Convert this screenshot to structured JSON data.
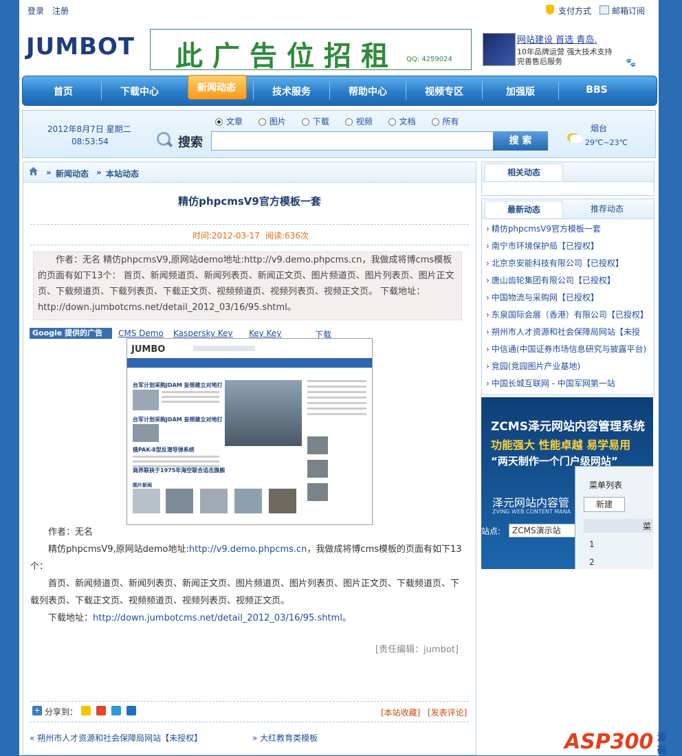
{
  "topbar": {
    "login": "登录",
    "register": "注册",
    "payment": "支付方式",
    "subscribe": "邮箱订阅"
  },
  "logo": "JUMBOT",
  "ad": {
    "text": "此广告位招租",
    "qq": "QQ: 4259024"
  },
  "promo": {
    "title": "网站建设 首选 青岛.",
    "line1": "10年品牌运营 强大技术支持",
    "line2": "完善售后服务"
  },
  "nav": {
    "items": [
      "首页",
      "下载中心",
      "新闻动态",
      "技术服务",
      "帮助中心",
      "视频专区",
      "加强版",
      "BBS"
    ],
    "active": "新闻动态"
  },
  "search": {
    "date": "2012年8月7日 星期二",
    "time": "08:53:54",
    "label": "搜索",
    "options": [
      "文章",
      "图片",
      "下载",
      "视频",
      "文档",
      "所有"
    ],
    "selected": "文章",
    "button": "搜 索",
    "city": "烟台",
    "temp": "29℃~23℃"
  },
  "breadcrumb": {
    "sep": "»",
    "level1": "新闻动态",
    "level2": "本站动态"
  },
  "article": {
    "title": "精仿phpcmsV9官方模板一套",
    "time": "时间:2012-03-17",
    "reads": "阅读:636次",
    "summary": "作者：无名 精仿phpcmsV9,原网站demo地址:http://v9.demo.phpcms.cn，我做成将博cms模板的页面有如下13个： 首页、新闻频道页、新闻列表页、新闻正文页、图片频道页、图片列表页、图片正文页、下载频道页、下载列表页、下载正文页、视频频道页、视频列表页、视频正文页。 下载地址：http://down.jumbotcms.net/detail_2012_03/16/95.shtml。",
    "author": "作者：无名",
    "p1_prefix": "精仿phpcmsV9,原网站demo地址:",
    "p1_link": "http://v9.demo.phpcms.cn",
    "p1_suffix": "，我做成将博cms模板的页面有如下13个：",
    "p2": "首页、新闻频道页、新闻列表页、新闻正文页、图片频道页、图片列表页、图片正文页、下载频道页、下载列表页、下载正文页、视频频道页、视频列表页、视频正文页。",
    "p3_prefix": "下载地址：",
    "p3_link": "http://down.jumbotcms.net/detail_2012_03/16/95.shtml",
    "p3_suffix": "。",
    "editor": "[责任编辑：jumbot]",
    "share": "分享到：",
    "fav": "[本站收藏]",
    "comment": "[发表评论]",
    "prev": "« 朔州市人才资源和社会保障局网站【未授权】",
    "next": "» 大红教育类模板"
  },
  "google_ads": {
    "label": "Google 提供的广告",
    "links": [
      "CMS Demo",
      "Kaspersky Key",
      "Key Key",
      "下载"
    ]
  },
  "screenshot": {
    "logo": "JUMBO",
    "headline1": "台军计划采购JDAM 妄想建立对地打",
    "headline2": "俄PAK-8型反潜导弹系统",
    "headline3": "商界联袂于1975年海空联合追击旗舰",
    "section": "图片新闻"
  },
  "sidebar": {
    "related_tab": "相关动态",
    "latest_tab": "最新动态",
    "recommend_tab": "推荐动态",
    "latest": [
      "精仿phpcmsV9官方模板一套",
      "南宁市环境保护局【已授权】",
      "北京京安能科技有限公司【已授权】",
      "唐山齿轮集团有限公司【已授权】",
      "中国物流与采购网【已授权】",
      "东泉国际会展（香港）有限公司【已授权】",
      "朔州市人才资源和社会保障局网站【未授",
      "中信通(中国证券市场信息研究与披露平台)",
      "竞园(竞园图片产业基地)",
      "中国长城互联网 - 中国军网第一站"
    ]
  },
  "zcms": {
    "title": "ZCMS泽元网站内容管理系统",
    "line1": "功能强大  性能卓越  易学易用",
    "line2": "“两天制作一个门户级网站”",
    "sub": "泽元网站内容管",
    "sub_en": "ZVING WEB CONTENT MANA",
    "menu": "菜单列表",
    "new": "新建",
    "site_label": "站点:",
    "site_value": "ZCMS演示站",
    "col": "菜"
  },
  "watermark": {
    "brand": "ASP300",
    "suffix": "源码"
  }
}
